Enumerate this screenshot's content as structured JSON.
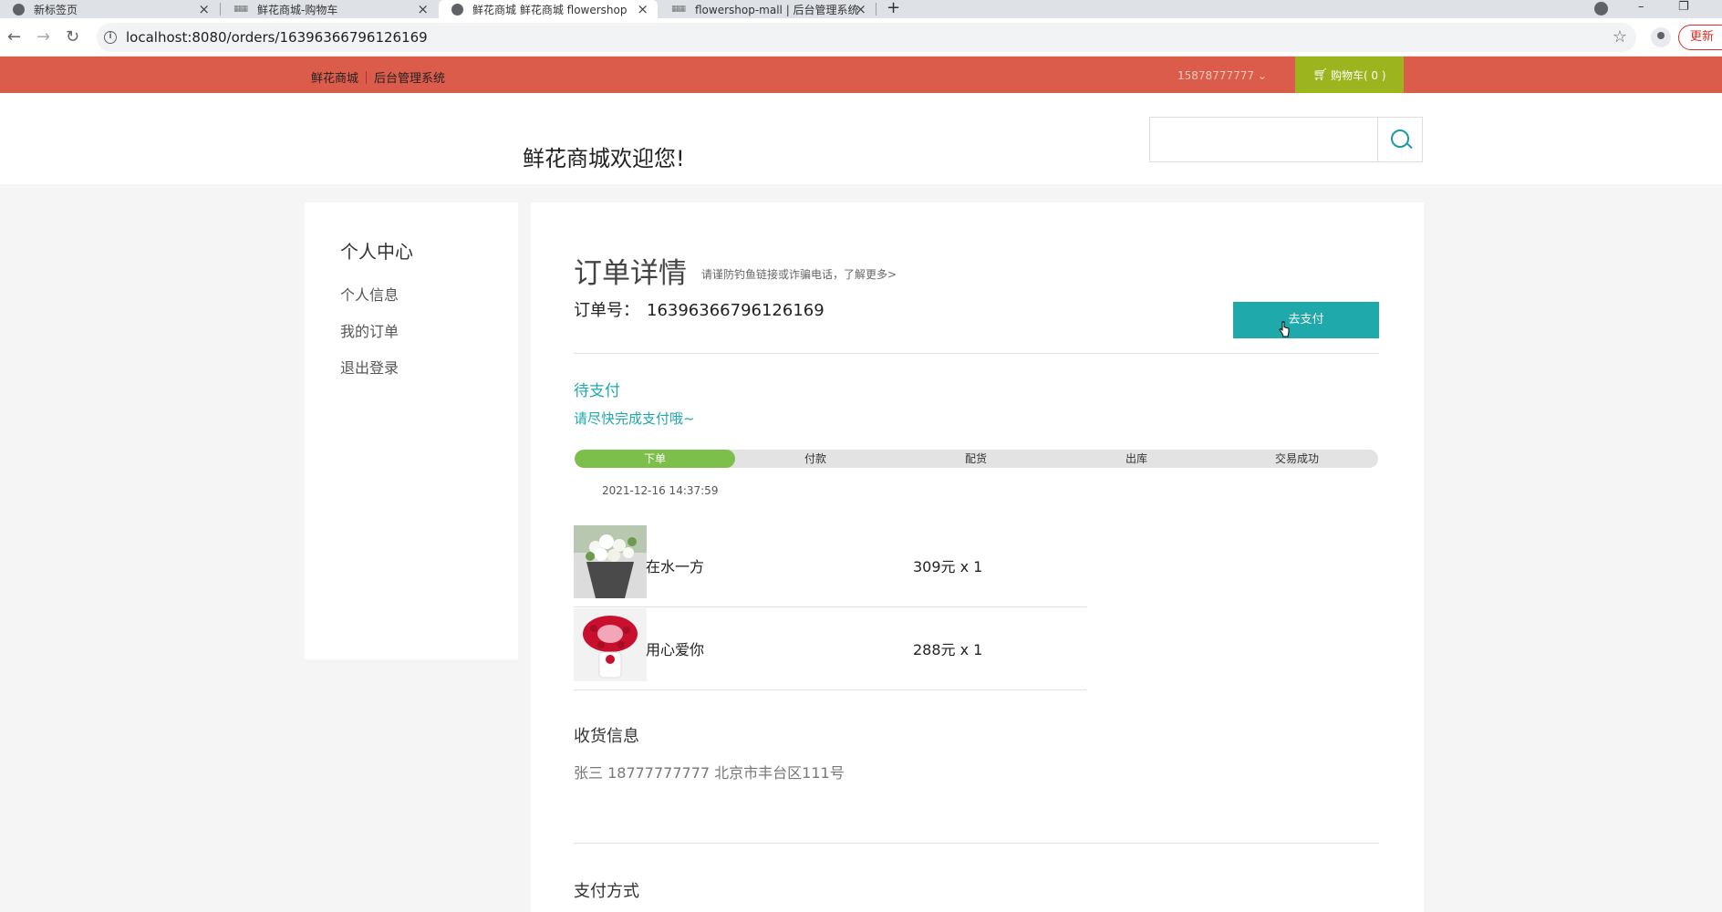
{
  "browser": {
    "tabs": [
      {
        "title": "新标签页"
      },
      {
        "title": "鲜花商城-购物车"
      },
      {
        "title": "鲜花商城 鲜花商城 flowershop"
      },
      {
        "title": "flowershop-mall | 后台管理系统"
      }
    ],
    "url": "localhost:8080/orders/16396366796126169",
    "update_label": "更新"
  },
  "topbar": {
    "nav": [
      "鲜花商城",
      "后台管理系统"
    ],
    "account": "15878777777",
    "cart_label": "购物车( 0 )"
  },
  "header": {
    "welcome": "鲜花商城欢迎您!",
    "search_placeholder": ""
  },
  "sidebar": {
    "title": "个人中心",
    "items": [
      "个人信息",
      "我的订单",
      "退出登录"
    ]
  },
  "order": {
    "title": "订单详情",
    "notice": "请谨防钓鱼链接或诈骗电话，了解更多>",
    "number_label": "订单号：",
    "number": "16396366796126169",
    "pay_button": "去支付",
    "status": "待支付",
    "status_sub": "请尽快完成支付哦~",
    "progress": {
      "steps": [
        "下单",
        "付款",
        "配货",
        "出库",
        "交易成功"
      ],
      "completed": 1
    },
    "time": "2021-12-16 14:37:59",
    "items": [
      {
        "name": "在水一方",
        "price": "309元 x 1",
        "image": "white-bouquet-image"
      },
      {
        "name": "用心爱你",
        "price": "288元 x 1",
        "image": "red-roses-image"
      }
    ],
    "shipping_title": "收货信息",
    "shipping": "张三 18777777777 北京市丰台区111号",
    "payment_title": "支付方式"
  },
  "colors": {
    "topbar": "#db5c4a",
    "cart": "#9cb41e",
    "accent": "#1fa9ab",
    "progress": "#7cbf4b"
  }
}
